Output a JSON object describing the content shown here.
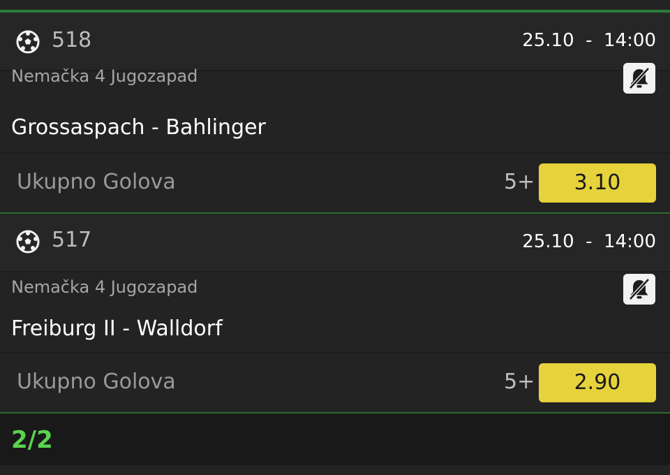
{
  "matches": [
    {
      "number": "518",
      "datetime": "25.10  -  14:00",
      "league": "Nemačka 4 Jugozapad",
      "teams": "Grossaspach - Bahlinger",
      "market": "Ukupno Golova",
      "outcome": "5+",
      "odd": "3.10",
      "sport_icon": "soccer-ball-icon",
      "notification_icon": "bell-off-icon"
    },
    {
      "number": "517",
      "datetime": "25.10  -  14:00",
      "league": "Nemačka 4 Jugozapad",
      "teams": "Freiburg II - Walldorf",
      "market": "Ukupno Golova",
      "outcome": "5+",
      "odd": "2.90",
      "sport_icon": "soccer-ball-icon",
      "notification_icon": "bell-off-icon"
    }
  ],
  "footer": {
    "count": "2/2"
  },
  "colors": {
    "background": "#232323",
    "odd_button": "#e6d23b",
    "accent_green": "#5ad34e",
    "separator_green": "#2e7a3c"
  }
}
